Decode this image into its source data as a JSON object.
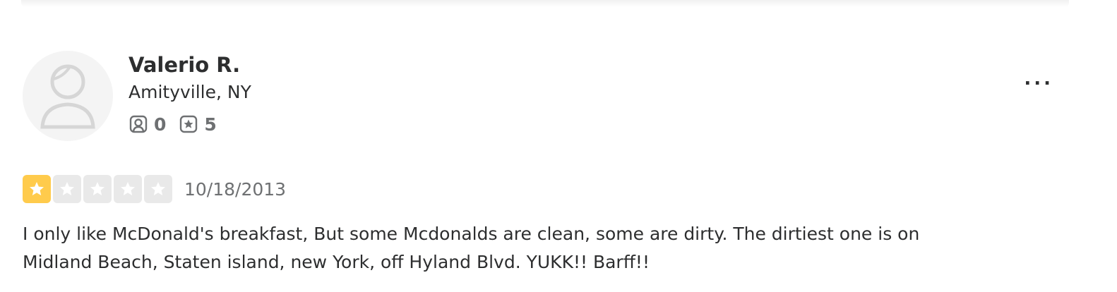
{
  "review": {
    "user": {
      "name": "Valerio R.",
      "location": "Amityville, NY",
      "friends_count": "0",
      "reviews_count": "5",
      "avatar_icon": "default-user-avatar-icon"
    },
    "rating": {
      "stars": 1,
      "max_stars": 5
    },
    "date": "10/18/2013",
    "text": "I only like McDonald's breakfast, But some Mcdonalds are clean, some are dirty. The dirtiest one is on Midland Beach, Staten island, new York, off Hyland Blvd. YUKK!! Barff!!",
    "more_menu_label": "..."
  },
  "colors": {
    "star_filled": "#ffcb4c",
    "star_empty": "#e9e9e9",
    "text_primary": "#2d2e2f",
    "text_secondary": "#6e7072"
  }
}
